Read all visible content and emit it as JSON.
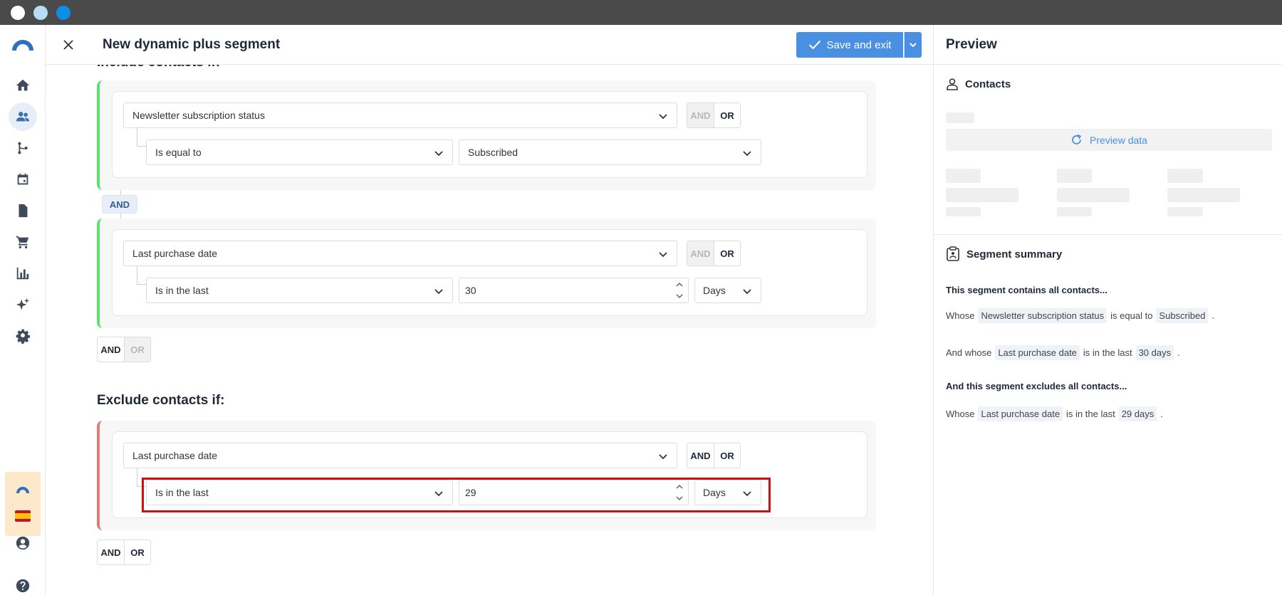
{
  "header": {
    "title": "New dynamic plus segment",
    "save_label": "Save and exit"
  },
  "icons": {
    "close": "close-icon",
    "check": "check-icon",
    "caret": "chevron-down-icon"
  },
  "include": {
    "heading": "Include contacts if:",
    "between_operator": "AND",
    "groups": [
      {
        "field": "Newsletter subscription status",
        "operator": "Is equal to",
        "value": "Subscribed",
        "toggle_and": "AND",
        "toggle_or": "OR"
      },
      {
        "field": "Last purchase date",
        "operator": "Is in the last",
        "value": "30",
        "unit": "Days",
        "toggle_and": "AND",
        "toggle_or": "OR"
      }
    ],
    "bottom_toggle": {
      "and": "AND",
      "or": "OR"
    }
  },
  "exclude": {
    "heading": "Exclude contacts if:",
    "groups": [
      {
        "field": "Last purchase date",
        "operator": "Is in the last",
        "value": "29",
        "unit": "Days",
        "toggle_and": "AND",
        "toggle_or": "OR"
      }
    ],
    "bottom_toggle": {
      "and": "AND",
      "or": "OR"
    }
  },
  "preview": {
    "title": "Preview",
    "contacts_label": "Contacts",
    "preview_data_label": "Preview data",
    "summary_title": "Segment summary",
    "contains_heading": "This segment contains all contacts...",
    "line1": {
      "prefix": "Whose",
      "field": "Newsletter subscription status",
      "op": "is equal to",
      "value": "Subscribed",
      "suffix": "."
    },
    "line2": {
      "prefix": "And whose",
      "field": "Last purchase date",
      "op": "is in the last",
      "value": "30 days",
      "suffix": "."
    },
    "excludes_heading": "And this segment excludes all contacts...",
    "line3": {
      "prefix": "Whose",
      "field": "Last purchase date",
      "op": "is in the last",
      "value": "29 days",
      "suffix": "."
    }
  },
  "colors": {
    "accent": "#4a90e2",
    "include_bar": "#5ee06a",
    "exclude_bar": "#e07a72",
    "highlight": "#d10e0e"
  }
}
